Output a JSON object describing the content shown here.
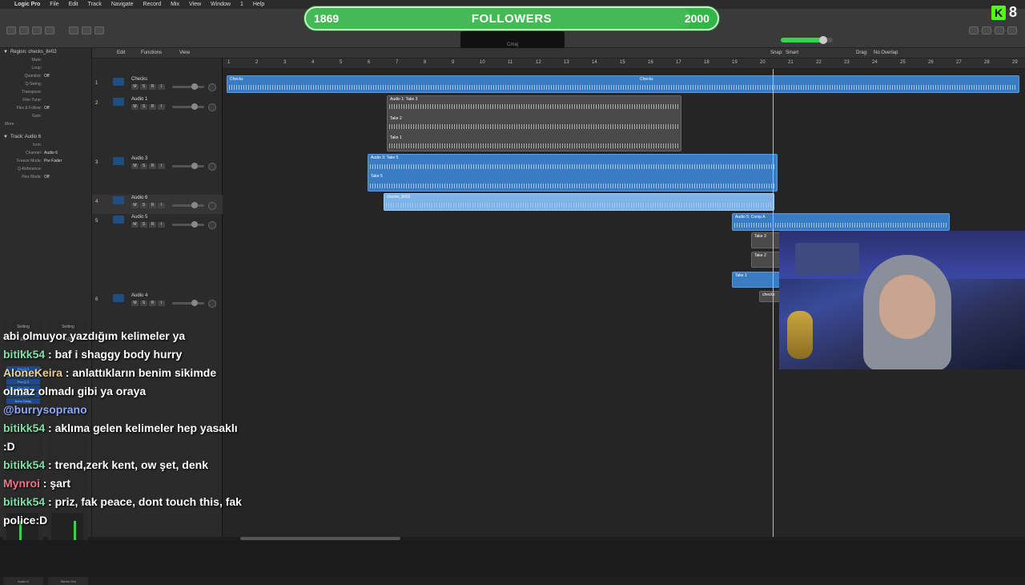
{
  "menubar": {
    "apple": "",
    "items": [
      "Logic Pro",
      "File",
      "Edit",
      "Track",
      "Navigate",
      "Record",
      "Mix",
      "View",
      "Window",
      "1",
      "Help"
    ]
  },
  "followers": {
    "current": "1869",
    "label": "FOLLOWERS",
    "goal": "2000",
    "progress_fraction": 0.935
  },
  "kick_badge": {
    "letter": "K",
    "count": "8"
  },
  "lcd": {
    "mode": "Cmaj"
  },
  "subbar": {
    "edit": "Edit",
    "functions": "Functions",
    "view": "View",
    "snap_label": "Snap:",
    "snap_value": "Smart",
    "drag_label": "Drag:",
    "drag_value": "No Overlap"
  },
  "ruler": {
    "ticks": [
      "1",
      "2",
      "3",
      "4",
      "5",
      "6",
      "7",
      "8",
      "9",
      "10",
      "11",
      "12",
      "13",
      "14",
      "15",
      "16",
      "17",
      "18",
      "19",
      "20",
      "21",
      "22",
      "23",
      "24",
      "25",
      "26",
      "27",
      "28",
      "29"
    ]
  },
  "inspector": {
    "region_header": "Region: checks_8#02",
    "region_rows": [
      {
        "label": "Mute:",
        "value": ""
      },
      {
        "label": "Loop:",
        "value": ""
      },
      {
        "label": "Quantize:",
        "value": "Off"
      },
      {
        "label": "Q-Swing:",
        "value": ""
      },
      {
        "label": "Transpose:",
        "value": ""
      },
      {
        "label": "Fine Tune:",
        "value": ""
      },
      {
        "label": "Flex & Follow:",
        "value": "Off"
      },
      {
        "label": "Gain:",
        "value": ""
      }
    ],
    "more": "More",
    "track_header": "Track: Audio 6",
    "track_rows": [
      {
        "label": "Icon:",
        "value": ""
      },
      {
        "label": "Channel:",
        "value": "Audio 6"
      },
      {
        "label": "Freeze Mode:",
        "value": "Pre Fader"
      },
      {
        "label": "Q-Reference:",
        "value": ""
      },
      {
        "label": "Flex Mode:",
        "value": "Off"
      }
    ],
    "strip_setting": "Setting",
    "strip_eq": "EQ",
    "strip_input": "Input 1",
    "plugins": [
      "Pro-Q 3",
      "Auto-Tune",
      "Pro-Q 3",
      "Pro-Q 3",
      "CLA Effect",
      "Echo Delay"
    ],
    "strip_names": [
      "Audio 6",
      "Stereo Out"
    ]
  },
  "tracks": [
    {
      "num": "1",
      "name": "Checks"
    },
    {
      "num": "2",
      "name": "Audio 1"
    },
    {
      "num": "3",
      "name": "Audio 3"
    },
    {
      "num": "4",
      "name": "Audio 6"
    },
    {
      "num": "5",
      "name": "Audio 5"
    },
    {
      "num": "6",
      "name": "Audio 4"
    }
  ],
  "track_buttons": [
    "M",
    "S",
    "R",
    "I"
  ],
  "regions": {
    "checks_a": "Checks",
    "checks_b": "Checks",
    "audio1_comp": "Audio 1: Take 3",
    "audio1_take2": "Take 2",
    "audio1_take1": "Take 1",
    "audio3_comp": "Audio 3: Take 5",
    "audio3_take5": "Take 5",
    "audio6": "checks_8#02",
    "audio5_comp": "Audio 5: Comp A",
    "audio5_take3": "Take 3",
    "audio5_take2": "Take 2",
    "audio5_take1": "Take 1",
    "audio5_small": "checks"
  },
  "chat": [
    {
      "user": "",
      "text": "abi olmuyor yazdığım kelimeler ya",
      "color": "#ffffff"
    },
    {
      "user": "bitikk54",
      "text": "baf i shaggy body hurry",
      "color": "#7ee0a4"
    },
    {
      "user": "AloneKeira",
      "text": "anlattıkların benim sikimde olmaz olmadı gibi ya oraya",
      "color": "#f0d090"
    },
    {
      "user": "",
      "text": "@burrysoprano",
      "color": "#8ea8ff"
    },
    {
      "user": "bitikk54",
      "text": "aklıma gelen kelimeler hep yasaklı :D",
      "color": "#7ee0a4"
    },
    {
      "user": "bitikk54",
      "text": "trend,zerk kent, ow şet, denk",
      "color": "#7ee0a4"
    },
    {
      "user": "Mynroi",
      "text": "şart",
      "color": "#ff6b8a"
    },
    {
      "user": "bitikk54",
      "text": "priz, fak peace, dont touch this, fak police:D",
      "color": "#7ee0a4"
    }
  ]
}
